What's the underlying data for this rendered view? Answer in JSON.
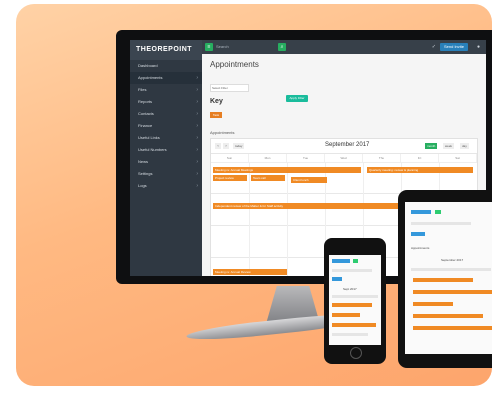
{
  "app": {
    "logo": "THEOREPOINT",
    "search_placeholder": "Search",
    "user_button": "Send Invite",
    "menu_icon": "grid-icon"
  },
  "sidebar": {
    "items": [
      {
        "label": "Dashboard"
      },
      {
        "label": "Appointments"
      },
      {
        "label": "Files"
      },
      {
        "label": "Reports"
      },
      {
        "label": "Contacts"
      },
      {
        "label": "Finance"
      },
      {
        "label": "Useful Links"
      },
      {
        "label": "Useful Numbers"
      },
      {
        "label": "News"
      },
      {
        "label": "Settings"
      },
      {
        "label": "Logs"
      }
    ]
  },
  "main": {
    "title": "Appointments",
    "filter_label": "Select Filter",
    "filter_button": "Apply Filter",
    "key_heading": "Key",
    "key_badge": "Task",
    "appointments_label": "Appointments"
  },
  "calendar": {
    "month": "September 2017",
    "today": "today",
    "views": [
      "month",
      "week",
      "day"
    ],
    "days": [
      "Sun",
      "Mon",
      "Tue",
      "Wed",
      "Thu",
      "Fri",
      "Sat"
    ],
    "events": [
      {
        "label": "Meeting re: Annual Meetings"
      },
      {
        "label": "Project review"
      },
      {
        "label": "Team call"
      },
      {
        "label": "Client lunch"
      },
      {
        "label": "Quarterly meeting: review & planning"
      },
      {
        "label": "Independent review of the Matter & for Staff activity"
      },
      {
        "label": "Meeting re: Annual Review"
      }
    ]
  },
  "colors": {
    "accent": "#f08a24",
    "sidebar": "#2f3842",
    "topbar": "#374049",
    "green": "#27ae60",
    "blue": "#2980b9",
    "background": "#fda56c"
  },
  "devices": {
    "phone_title": "Sept 2017",
    "tablet_title": "September 2017"
  }
}
